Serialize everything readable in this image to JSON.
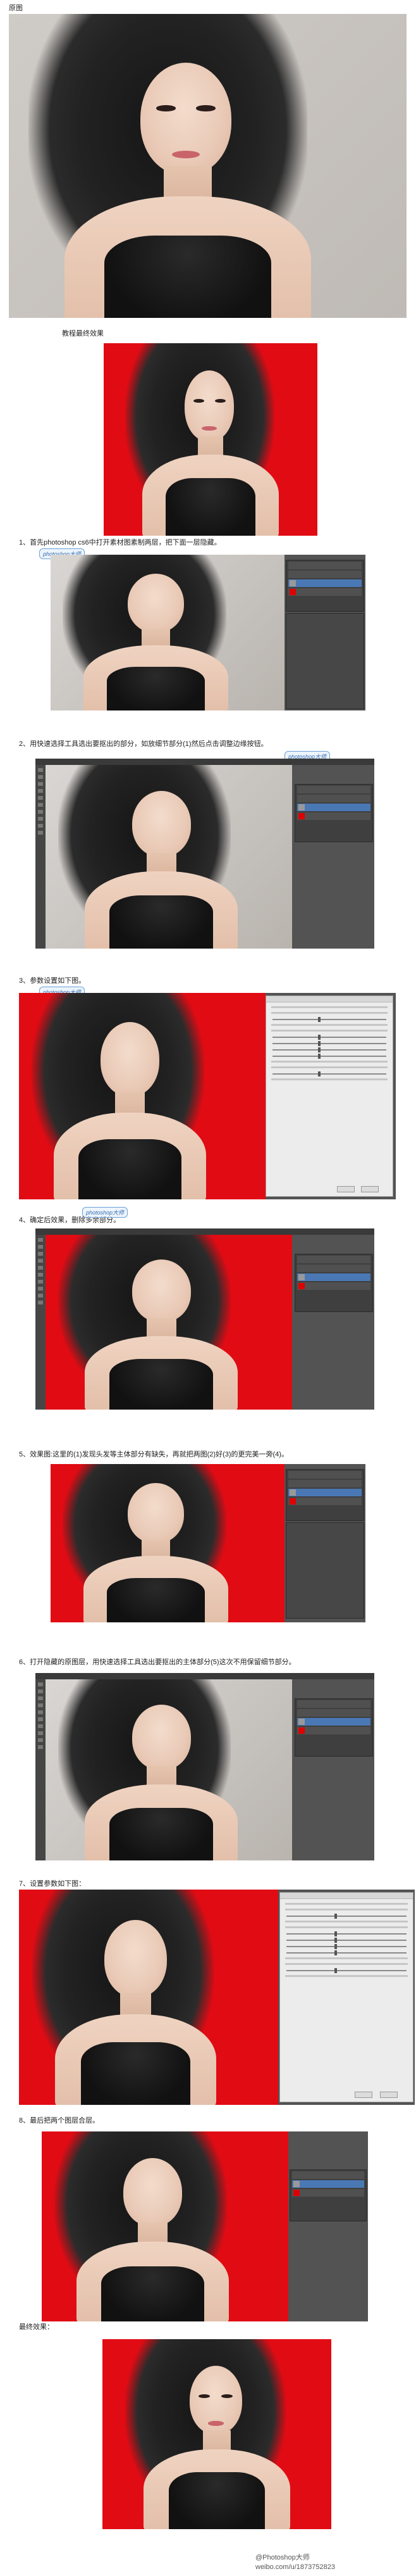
{
  "labels": {
    "original": "原图",
    "preview": "教程最终效果",
    "final": "最终效果："
  },
  "steps": [
    {
      "num": "1、",
      "text": "首先photoshop cs6中打开素材图素制两层，把下面一层隐藏。"
    },
    {
      "num": "2、",
      "text": "用快速选择工具选出要抠出的部分，如放细节部分(1)然后点击调整边缘按钮。"
    },
    {
      "num": "3、",
      "text": "参数设置如下图。"
    },
    {
      "num": "4、",
      "text": "确定后效果，删除多余部分。"
    },
    {
      "num": "5、",
      "text": "效果图:这里的(1)发现头发等主体部分有缺失，再就把两图(2)好(3)的更完美一旁(4)。"
    },
    {
      "num": "6、",
      "text": "打开隐藏的原图层，用快速选择工具选出要抠出的主体部分(5)这次不用保留细节部分。"
    },
    {
      "num": "7、",
      "text": "设置参数如下图："
    },
    {
      "num": "8、",
      "text": "最后把两个图层合层。"
    }
  ],
  "watermark": "photoshop大师",
  "footer": "weibo.com/u/1873752823",
  "footer_brand": "@Photoshop大师"
}
